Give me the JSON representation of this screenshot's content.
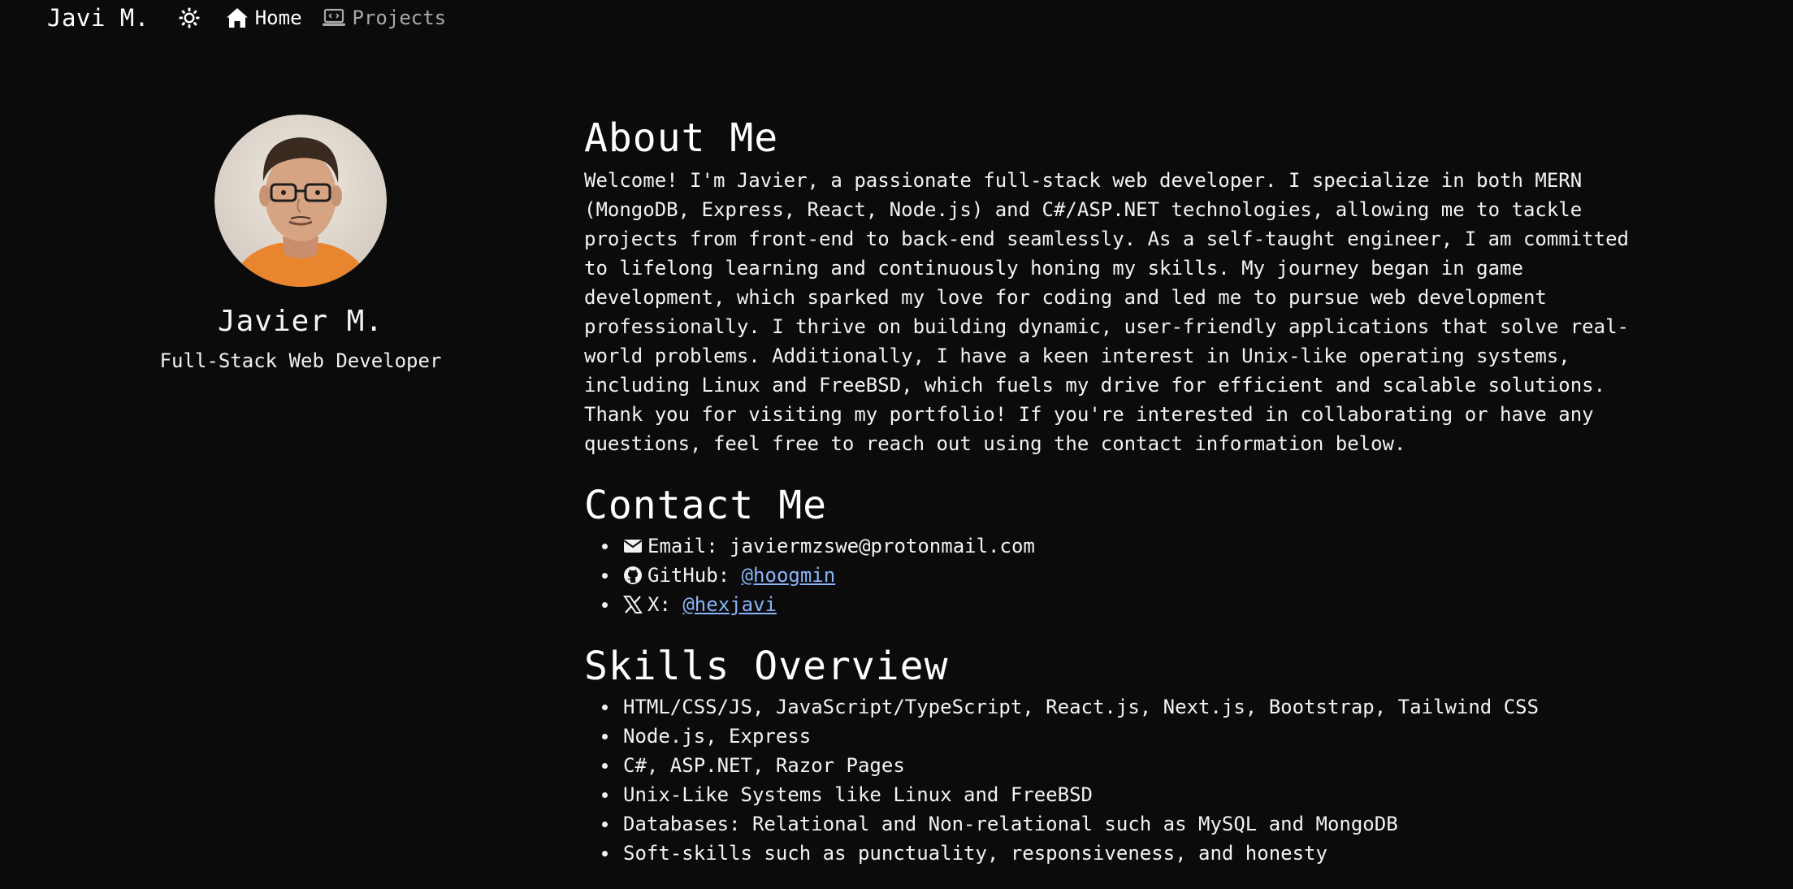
{
  "nav": {
    "brand": "Javi M.",
    "theme_icon": "sun-icon",
    "links": [
      {
        "label": "Home",
        "icon": "home-icon",
        "active": true
      },
      {
        "label": "Projects",
        "icon": "laptop-code-icon",
        "active": false
      }
    ]
  },
  "profile": {
    "name": "Javier M.",
    "title": "Full-Stack Web Developer"
  },
  "about": {
    "heading": "About Me",
    "text": "Welcome! I'm Javier, a passionate full-stack web developer. I specialize in both MERN (MongoDB, Express, React, Node.js) and C#/ASP.NET technologies, allowing me to tackle projects from front-end to back-end seamlessly. As a self-taught engineer, I am committed to lifelong learning and continuously honing my skills. My journey began in game development, which sparked my love for coding and led me to pursue web development professionally. I thrive on building dynamic, user-friendly applications that solve real-world problems. Additionally, I have a keen interest in Unix-like operating systems, including Linux and FreeBSD, which fuels my drive for efficient and scalable solutions. Thank you for visiting my portfolio! If you're interested in collaborating or have any questions, feel free to reach out using the contact information below."
  },
  "contact": {
    "heading": "Contact Me",
    "email_label": "Email:",
    "email_value": "javiermzswe@protonmail.com",
    "github_label": "GitHub:",
    "github_value": "@hoogmin",
    "x_label": "X:",
    "x_value": "@hexjavi"
  },
  "skills": {
    "heading": "Skills Overview",
    "items": [
      "HTML/CSS/JS, JavaScript/TypeScript, React.js, Next.js, Bootstrap, Tailwind CSS",
      "Node.js, Express",
      "C#, ASP.NET, Razor Pages",
      "Unix-Like Systems like Linux and FreeBSD",
      "Databases: Relational and Non-relational such as MySQL and MongoDB",
      "Soft-skills such as punctuality, responsiveness, and honesty"
    ]
  },
  "colors": {
    "background": "#0b0b0b",
    "text": "#f2f2f2",
    "link": "#8ab4f8",
    "muted": "#a9a9a9"
  }
}
